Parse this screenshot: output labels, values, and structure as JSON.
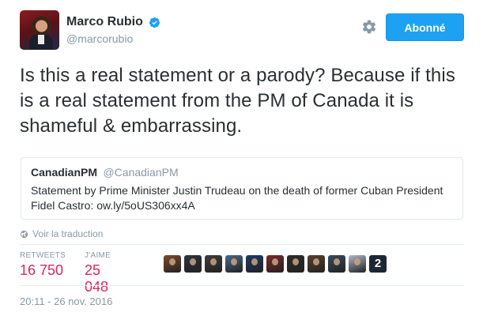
{
  "author": {
    "name": "Marco Rubio",
    "handle": "@marcorubio",
    "verified": true
  },
  "follow_button": {
    "label": "Abonné",
    "color": "#1da1f2"
  },
  "tweet": {
    "text": "Is this a real statement or a parody? Because if this is a real statement from the PM of Canada it is shameful & embarrassing."
  },
  "quoted": {
    "name": "CanadianPM",
    "handle": "@CanadianPM",
    "text": "Statement by Prime Minister Justin Trudeau on the death of former Cuban President Fidel Castro:  ow.ly/5oUS306xx4A"
  },
  "translate_link": "Voir la traduction",
  "stats": {
    "retweets_label": "RETWEETS",
    "retweets_value": "16 750",
    "likes_label": "J'AIME",
    "likes_value": "25 048"
  },
  "likers": [
    {
      "icon": "liker-avatar-1",
      "color": "#7a4a2a"
    },
    {
      "icon": "liker-avatar-2",
      "color": "#2a3440"
    },
    {
      "icon": "liker-avatar-3",
      "color": "#3d3d3d"
    },
    {
      "icon": "liker-avatar-4",
      "color": "#4a6a8a"
    },
    {
      "icon": "liker-avatar-5",
      "color": "#1e3a6a"
    },
    {
      "icon": "liker-avatar-6",
      "color": "#7a2a2a"
    },
    {
      "icon": "liker-avatar-7",
      "color": "#2c2c2c"
    },
    {
      "icon": "liker-avatar-8",
      "color": "#5a4030"
    },
    {
      "icon": "liker-avatar-9",
      "color": "#3a4a5a"
    },
    {
      "icon": "liker-avatar-10",
      "color": "#b0b8c8"
    }
  ],
  "liker_overflow": "2",
  "timestamp": "20:11 - 26 nov. 2016"
}
